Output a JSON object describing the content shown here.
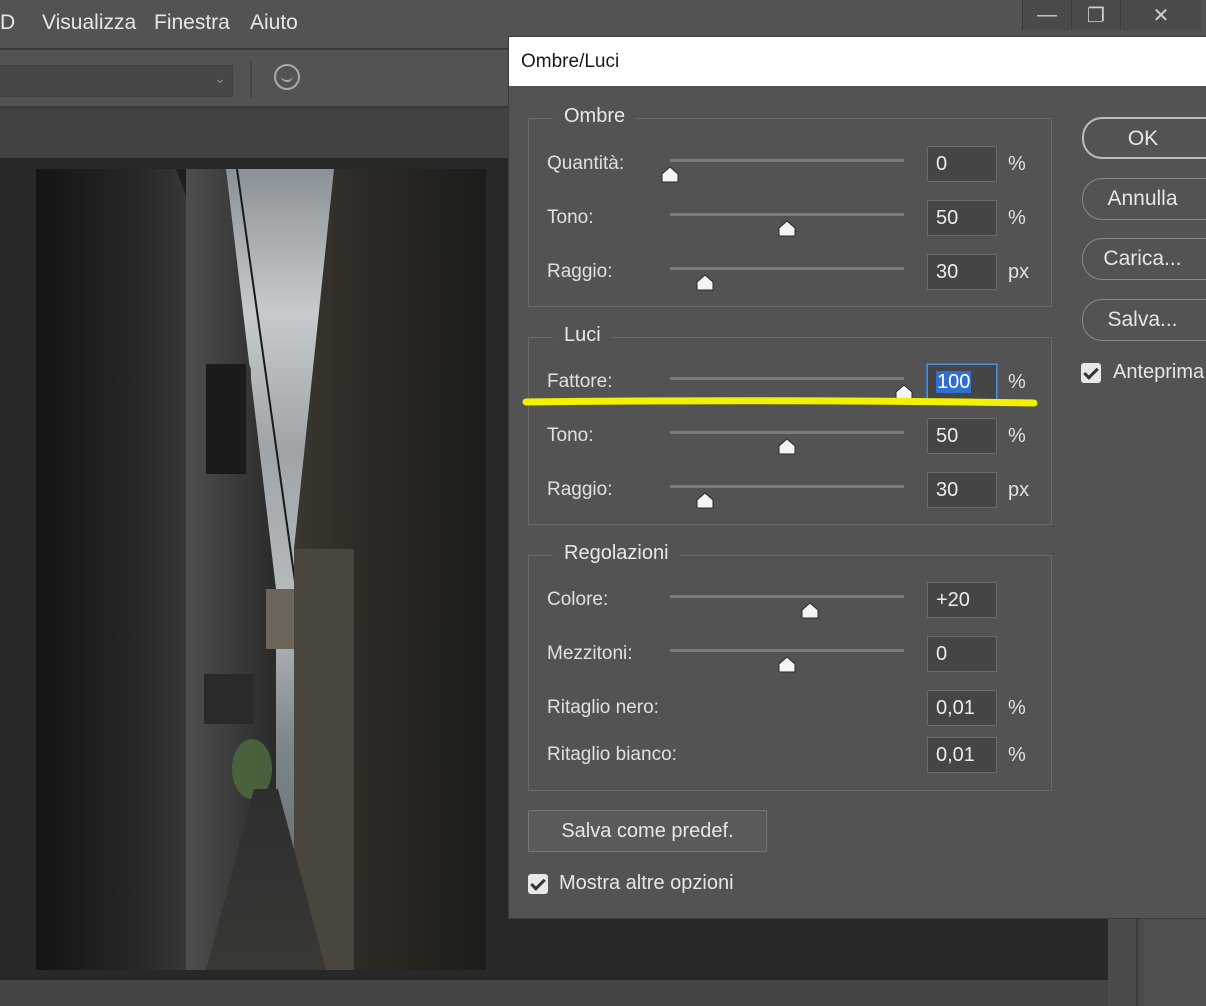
{
  "menubar": {
    "items": [
      "D",
      "Visualizza",
      "Finestra",
      "Aiuto"
    ],
    "window_buttons": {
      "minimize": "—",
      "restore": "❐",
      "close": "✕"
    }
  },
  "options_bar": {
    "combo_arrow": "⌄"
  },
  "dialog": {
    "title": "Ombre/Luci",
    "groups": {
      "ombre": {
        "title": "Ombre",
        "rows": [
          {
            "label": "Quantità:",
            "value": "0",
            "unit": "%",
            "slider": 0
          },
          {
            "label": "Tono:",
            "value": "50",
            "unit": "%",
            "slider": 50
          },
          {
            "label": "Raggio:",
            "value": "30",
            "unit": "px",
            "slider": 15
          }
        ]
      },
      "luci": {
        "title": "Luci",
        "rows": [
          {
            "label": "Fattore:",
            "value": "100",
            "unit": "%",
            "slider": 100
          },
          {
            "label": "Tono:",
            "value": "50",
            "unit": "%",
            "slider": 50
          },
          {
            "label": "Raggio:",
            "value": "30",
            "unit": "px",
            "slider": 15
          }
        ]
      },
      "regolazioni": {
        "title": "Regolazioni",
        "rows": [
          {
            "label": "Colore:",
            "value": "+20",
            "unit": "",
            "slider": 60
          },
          {
            "label": "Mezzitoni:",
            "value": "0",
            "unit": "",
            "slider": 50
          },
          {
            "label": "Ritaglio nero:",
            "value": "0,01",
            "unit": "%"
          },
          {
            "label": "Ritaglio bianco:",
            "value": "0,01",
            "unit": "%"
          }
        ]
      }
    },
    "buttons": {
      "ok": "OK",
      "annulla": "Annulla",
      "carica": "Carica...",
      "salva": "Salva...",
      "salva_predef": "Salva come predef."
    },
    "checkboxes": {
      "anteprima": {
        "label": "Anteprima",
        "checked": true
      },
      "mostra": {
        "label": "Mostra altre opzioni",
        "checked": true
      }
    }
  },
  "colors": {
    "highlight_stroke": "#f2f200",
    "focus_blue": "#2f6fd0",
    "panel_bg": "#535353"
  }
}
